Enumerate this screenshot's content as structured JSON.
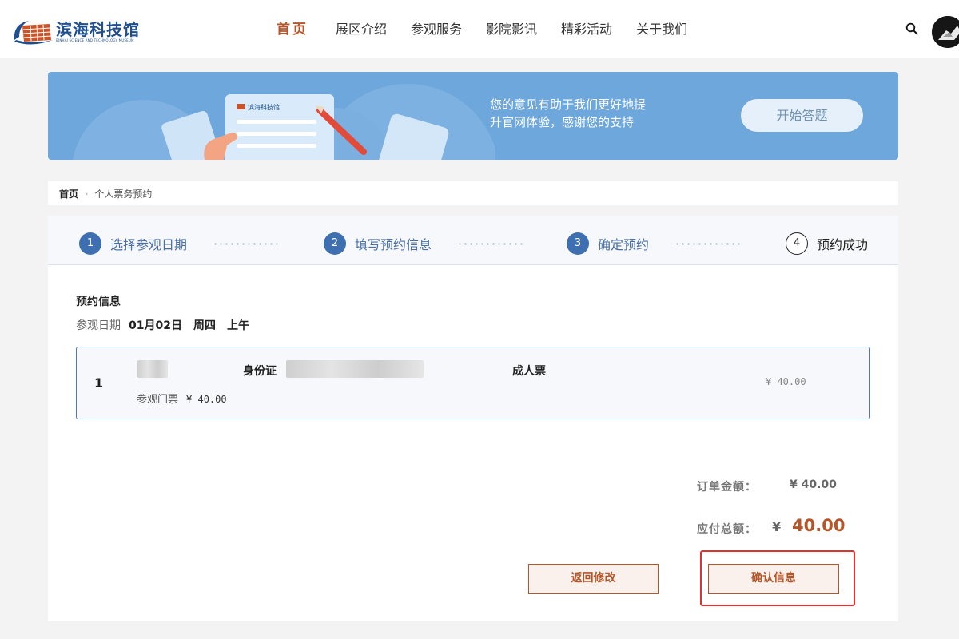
{
  "header": {
    "logo_name": "滨海科技馆",
    "logo_subtitle": "BINHAI SCIENCE AND TECHNOLOGY MUSEUM",
    "nav": [
      {
        "label": "首页",
        "active": true
      },
      {
        "label": "展区介绍",
        "active": false
      },
      {
        "label": "参观服务",
        "active": false
      },
      {
        "label": "影院影讯",
        "active": false
      },
      {
        "label": "精彩活动",
        "active": false
      },
      {
        "label": "关于我们",
        "active": false
      }
    ],
    "icons": {
      "search": "search-icon",
      "avatar": "avatar"
    }
  },
  "banner": {
    "card_title": "滨海科技馆",
    "line1": "您的意见有助于我们更好地提",
    "line2": "升官网体验，感谢您的支持",
    "button_label": "开始答题"
  },
  "breadcrumb": {
    "home": "首页",
    "separator": "›",
    "current": "个人票务预约"
  },
  "steps": [
    {
      "num": "1",
      "label": "选择参观日期",
      "done": true
    },
    {
      "num": "2",
      "label": "填写预约信息",
      "done": true
    },
    {
      "num": "3",
      "label": "确定预约",
      "done": true
    },
    {
      "num": "4",
      "label": "预约成功",
      "done": false
    }
  ],
  "reservation": {
    "title": "预约信息",
    "visit_label": "参观日期",
    "visit_date": "01月02日",
    "visit_weekday": "周四",
    "visit_period": "上午"
  },
  "ticket": {
    "index": "1",
    "id_label": "身份证",
    "ticket_type": "成人票",
    "ticket_name": "参观门票",
    "unit_price": "¥ 40.00",
    "line_price": "¥ 40.00"
  },
  "summary": {
    "order_label": "订单金额：",
    "order_value": "¥ 40.00",
    "total_label": "应付总额：",
    "total_currency": "¥",
    "total_value": "40.00"
  },
  "buttons": {
    "back": "返回修改",
    "confirm": "确认信息"
  },
  "colors": {
    "accent": "#b5562a",
    "step_blue": "#3e6fb0",
    "banner_blue": "#6ea7dc",
    "highlight_red": "#e23131"
  }
}
